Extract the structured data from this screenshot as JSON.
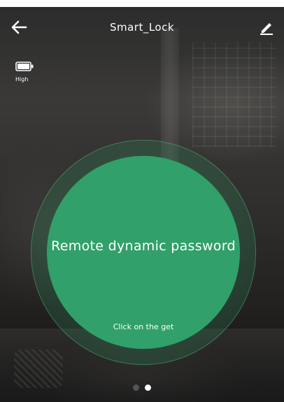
{
  "header": {
    "title": "Smart_Lock",
    "back_icon": "arrow-left-icon",
    "edit_icon": "pencil-icon"
  },
  "battery": {
    "icon": "battery-icon",
    "label": "High"
  },
  "main": {
    "title": "Remote dynamic password",
    "hint": "Click on the get",
    "accent_color": "#31a06a"
  },
  "pager": {
    "total": 2,
    "active_index": 1
  }
}
